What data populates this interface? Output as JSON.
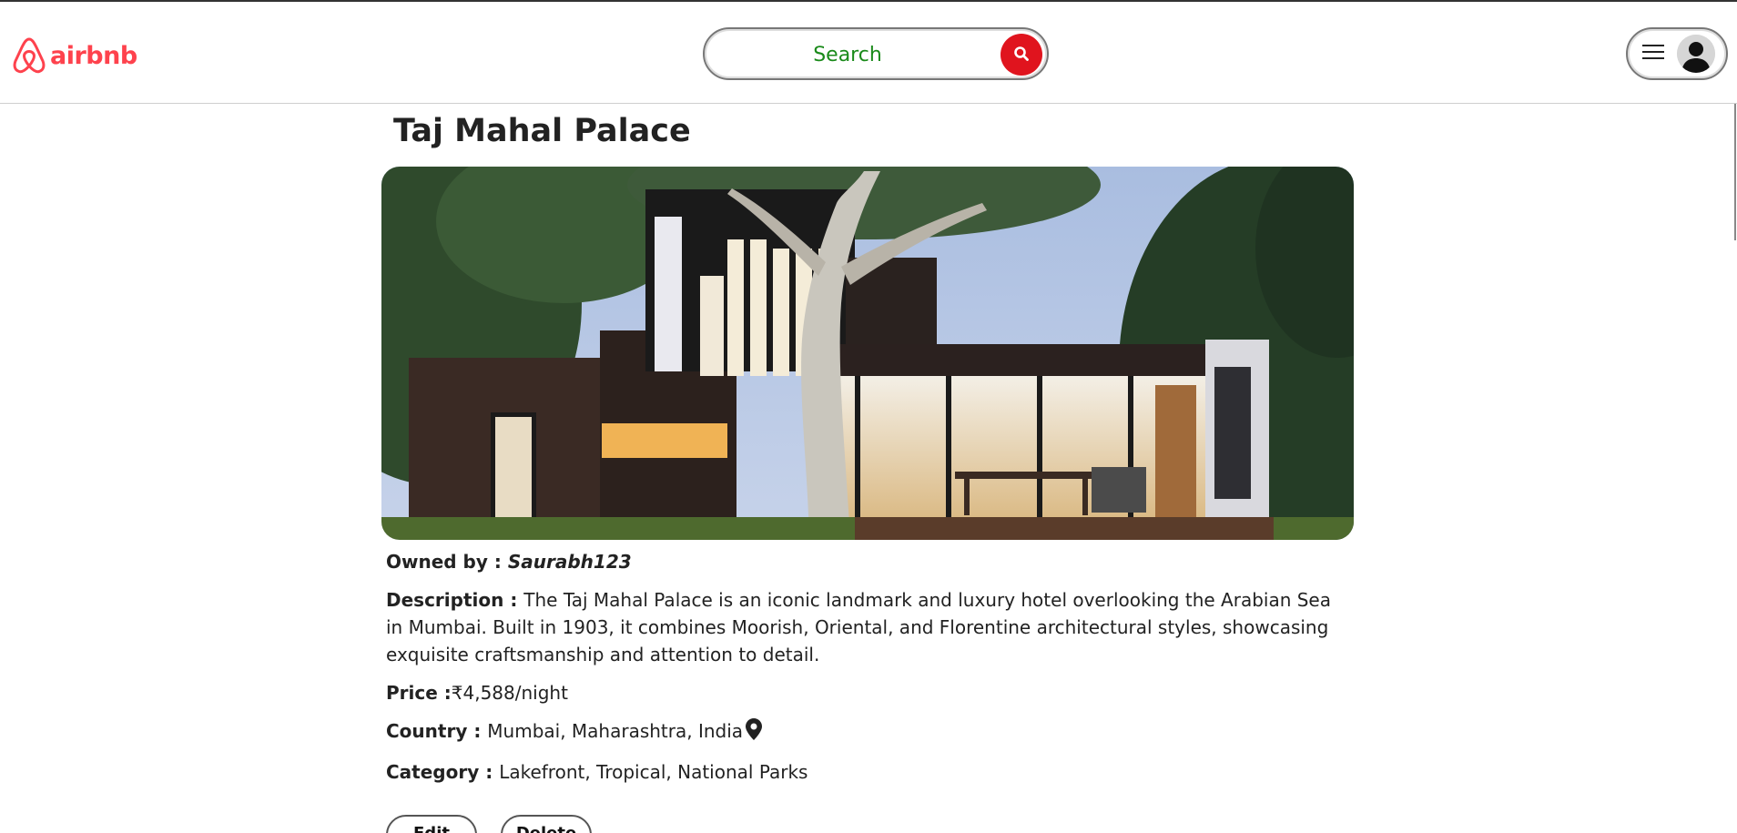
{
  "brand": {
    "name": "airbnb",
    "color": "#fe424d"
  },
  "search": {
    "placeholder": "Search",
    "button_icon": "search-icon",
    "accent": "#e0141e"
  },
  "user_menu": {
    "icons": [
      "hamburger-menu-icon",
      "user-avatar-icon"
    ]
  },
  "listing": {
    "title": "Taj Mahal Palace",
    "image_alt": "Modern two-storey house at dusk with a large tree and lit interior",
    "owner_label": "Owned by : ",
    "owner": "Saurabh123",
    "description_label": "Description : ",
    "description": "The Taj Mahal Palace is an iconic landmark and luxury hotel overlooking the Arabian Sea in Mumbai. Built in 1903, it combines Moorish, Oriental, and Florentine architectural styles, showcasing exquisite craftsmanship and attention to detail.",
    "price_label": "Price :",
    "price": "₹4,588/night",
    "country_label": "Country : ",
    "country": "Mumbai, Maharashtra, India",
    "category_label": "Category : ",
    "category": "Lakefront, Tropical, National Parks"
  },
  "actions": {
    "edit_label": "Edit",
    "delete_label": "Delete"
  }
}
